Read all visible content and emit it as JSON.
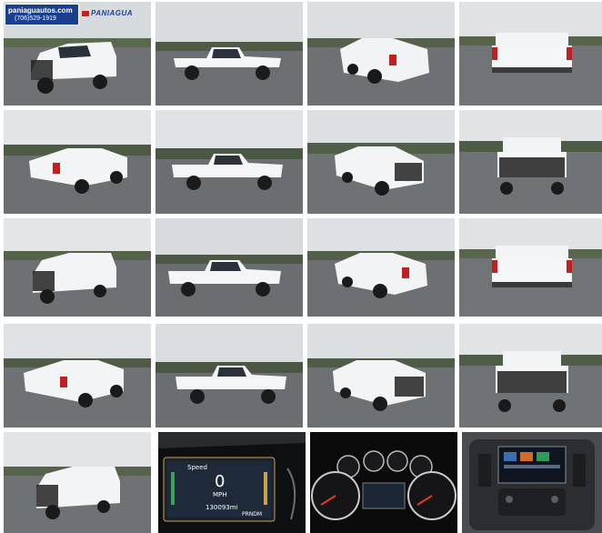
{
  "dealer": {
    "website": "paniaguautos.com",
    "phone": "(706)529-1919",
    "logo_text": "PANIAGUA"
  },
  "gallery": {
    "photos": [
      {
        "subject": "white-pickup-front-three-quarter-left-with-grille-guard"
      },
      {
        "subject": "white-pickup-side-profile-left"
      },
      {
        "subject": "white-pickup-rear-three-quarter-left"
      },
      {
        "subject": "white-pickup-rear"
      },
      {
        "subject": "white-pickup-rear-three-quarter-left"
      },
      {
        "subject": "white-pickup-side-profile-left"
      },
      {
        "subject": "white-pickup-front-three-quarter-right-with-grille-guard"
      },
      {
        "subject": "white-pickup-front-with-grille-guard"
      },
      {
        "subject": "white-pickup-front-three-quarter-left-with-grille-guard"
      },
      {
        "subject": "white-pickup-side-profile-left"
      },
      {
        "subject": "white-pickup-rear-three-quarter-left"
      },
      {
        "subject": "white-pickup-rear"
      },
      {
        "subject": "white-pickup-rear-three-quarter-left"
      },
      {
        "subject": "white-pickup-side-profile-left"
      },
      {
        "subject": "white-pickup-front-three-quarter-right-with-grille-guard"
      },
      {
        "subject": "white-pickup-front-with-grille-guard"
      },
      {
        "subject": "white-pickup-front-three-quarter-left-with-grille-guard"
      },
      {
        "subject": "digital-speedometer-display"
      },
      {
        "subject": "instrument-cluster-gauges"
      },
      {
        "subject": "center-console-infotainment-screen"
      }
    ]
  },
  "dash": {
    "speed_label": "Speed",
    "speed_value": "0",
    "speed_unit": "MPH",
    "odometer": "130093mi",
    "gear": "PRNDM"
  }
}
